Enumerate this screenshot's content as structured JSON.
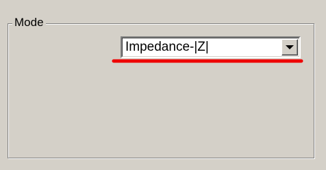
{
  "mode_group": {
    "title": "Mode",
    "combo": {
      "value": "Impedance-|Z|",
      "button_icon": "chevron-down-icon"
    }
  },
  "colors": {
    "background": "#d4d0c8",
    "annotation_underline": "#ee0000"
  }
}
